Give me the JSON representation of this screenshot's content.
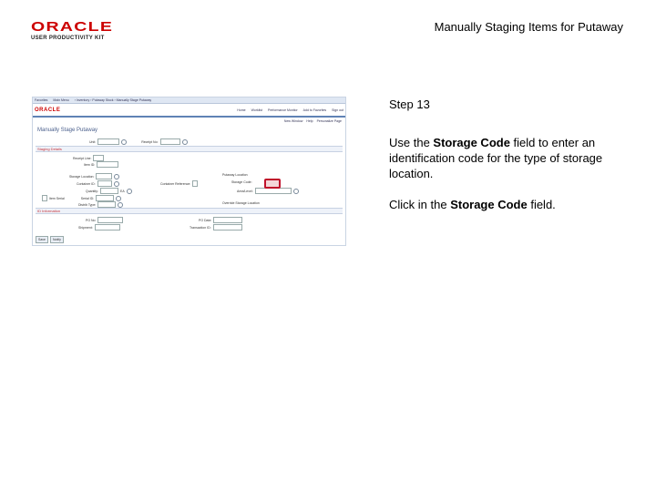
{
  "header": {
    "logo_main": "ORACLE",
    "logo_sub": "USER PRODUCTIVITY KIT",
    "doc_title": "Manually Staging Items for Putaway"
  },
  "step": {
    "label": "Step 13"
  },
  "instructions": {
    "p1_pre": "Use the ",
    "p1_bold": "Storage Code",
    "p1_post": " field to enter an identification code for the type of storage location.",
    "p2_pre": "Click in the ",
    "p2_bold": "Storage Code",
    "p2_post": " field."
  },
  "screenshot": {
    "brand": "ORACLE",
    "page_title": "Manually Stage Putaway",
    "section_staging": "Staging Details",
    "section_id": "ID Information",
    "buttons": {
      "save": "Save",
      "notify": "Notify"
    },
    "highlight_field": "storage-code-field"
  }
}
